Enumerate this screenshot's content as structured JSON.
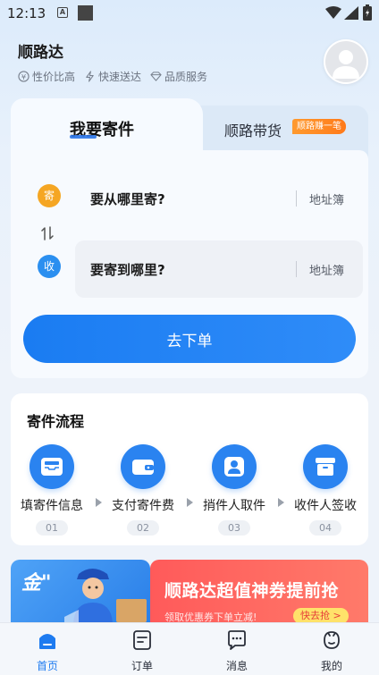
{
  "status_bar": {
    "time": "12:13",
    "notification_a": "A"
  },
  "header": {
    "app_title": "顺路达",
    "features": [
      {
        "label": "性价比高",
        "icon": "coin-icon"
      },
      {
        "label": "快速送达",
        "icon": "lightning-icon"
      },
      {
        "label": "品质服务",
        "icon": "diamond-icon"
      }
    ]
  },
  "tabs": {
    "send_label": "我要寄件",
    "carry_label": "顺路带货",
    "carry_badge": "顺路赚一笔"
  },
  "address": {
    "from_badge": "寄",
    "from_text": "要从哪里寄?",
    "to_badge": "收",
    "to_text": "要寄到哪里?",
    "address_book": "地址簿"
  },
  "submit_label": "去下单",
  "process": {
    "title": "寄件流程",
    "steps": [
      {
        "label": "填寄件信息",
        "num": "01",
        "icon": "inbox-icon"
      },
      {
        "label": "支付寄件费",
        "num": "02",
        "icon": "wallet-icon"
      },
      {
        "label": "捎件人取件",
        "num": "03",
        "icon": "courier-icon"
      },
      {
        "label": "收件人签收",
        "num": "04",
        "icon": "package-icon"
      }
    ]
  },
  "banners": {
    "left_text": "金\"",
    "right_title": "顺路达超值神券提前抢",
    "right_sub": "领取优惠券下单立减!",
    "right_button": "快去抢 >"
  },
  "nav": [
    {
      "label": "首页",
      "icon": "home-icon",
      "active": true
    },
    {
      "label": "订单",
      "icon": "order-icon",
      "active": false
    },
    {
      "label": "消息",
      "icon": "message-icon",
      "active": false
    },
    {
      "label": "我的",
      "icon": "profile-icon",
      "active": false
    }
  ],
  "colors": {
    "accent": "#1e7bf0",
    "send_dot": "#f5a623",
    "receive_dot": "#2b8ff0",
    "badge_orange": "#ff8a24"
  }
}
